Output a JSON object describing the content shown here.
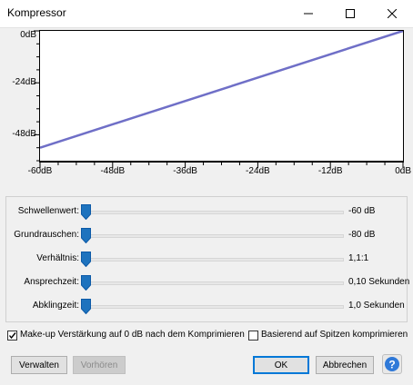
{
  "window": {
    "title": "Kompressor",
    "controls": [
      "minimize-icon",
      "maximize-icon",
      "close-icon"
    ]
  },
  "chart_data": {
    "type": "line",
    "x": [
      -60,
      0
    ],
    "series": [
      {
        "values": [
          -54,
          0
        ]
      }
    ],
    "xlim": [
      -60,
      0
    ],
    "ylim": [
      -60,
      0
    ],
    "x_ticks": [
      "-60dB",
      "-48dB",
      "-36dB",
      "-24dB",
      "-12dB",
      "0dB"
    ],
    "y_ticks": [
      "0dB",
      "-24dB",
      "-48dB"
    ],
    "line_color": "#6f6fc7"
  },
  "sliders": [
    {
      "label": "Schwellenwert:",
      "value": "-60 dB",
      "position": 0.0
    },
    {
      "label": "Grundrauschen:",
      "value": "-80 dB",
      "position": 0.0
    },
    {
      "label": "Verhältnis:",
      "value": "1,1:1",
      "position": 0.0
    },
    {
      "label": "Ansprechzeit:",
      "value": "0,10 Sekunden",
      "position": 0.0
    },
    {
      "label": "Abklingzeit:",
      "value": "1,0 Sekunden",
      "position": 0.0
    }
  ],
  "options": {
    "makeup_label": "Make-up Verstärkung auf 0 dB nach dem Komprimieren",
    "makeup_checked": true,
    "peaks_label": "Basierend auf Spitzen komprimieren",
    "peaks_checked": false
  },
  "buttons": {
    "manage": "Verwalten",
    "preview": "Vorhören",
    "ok": "OK",
    "cancel": "Abbrechen"
  },
  "colors": {
    "accent": "#0078d7",
    "thumb": "#1e73be"
  }
}
